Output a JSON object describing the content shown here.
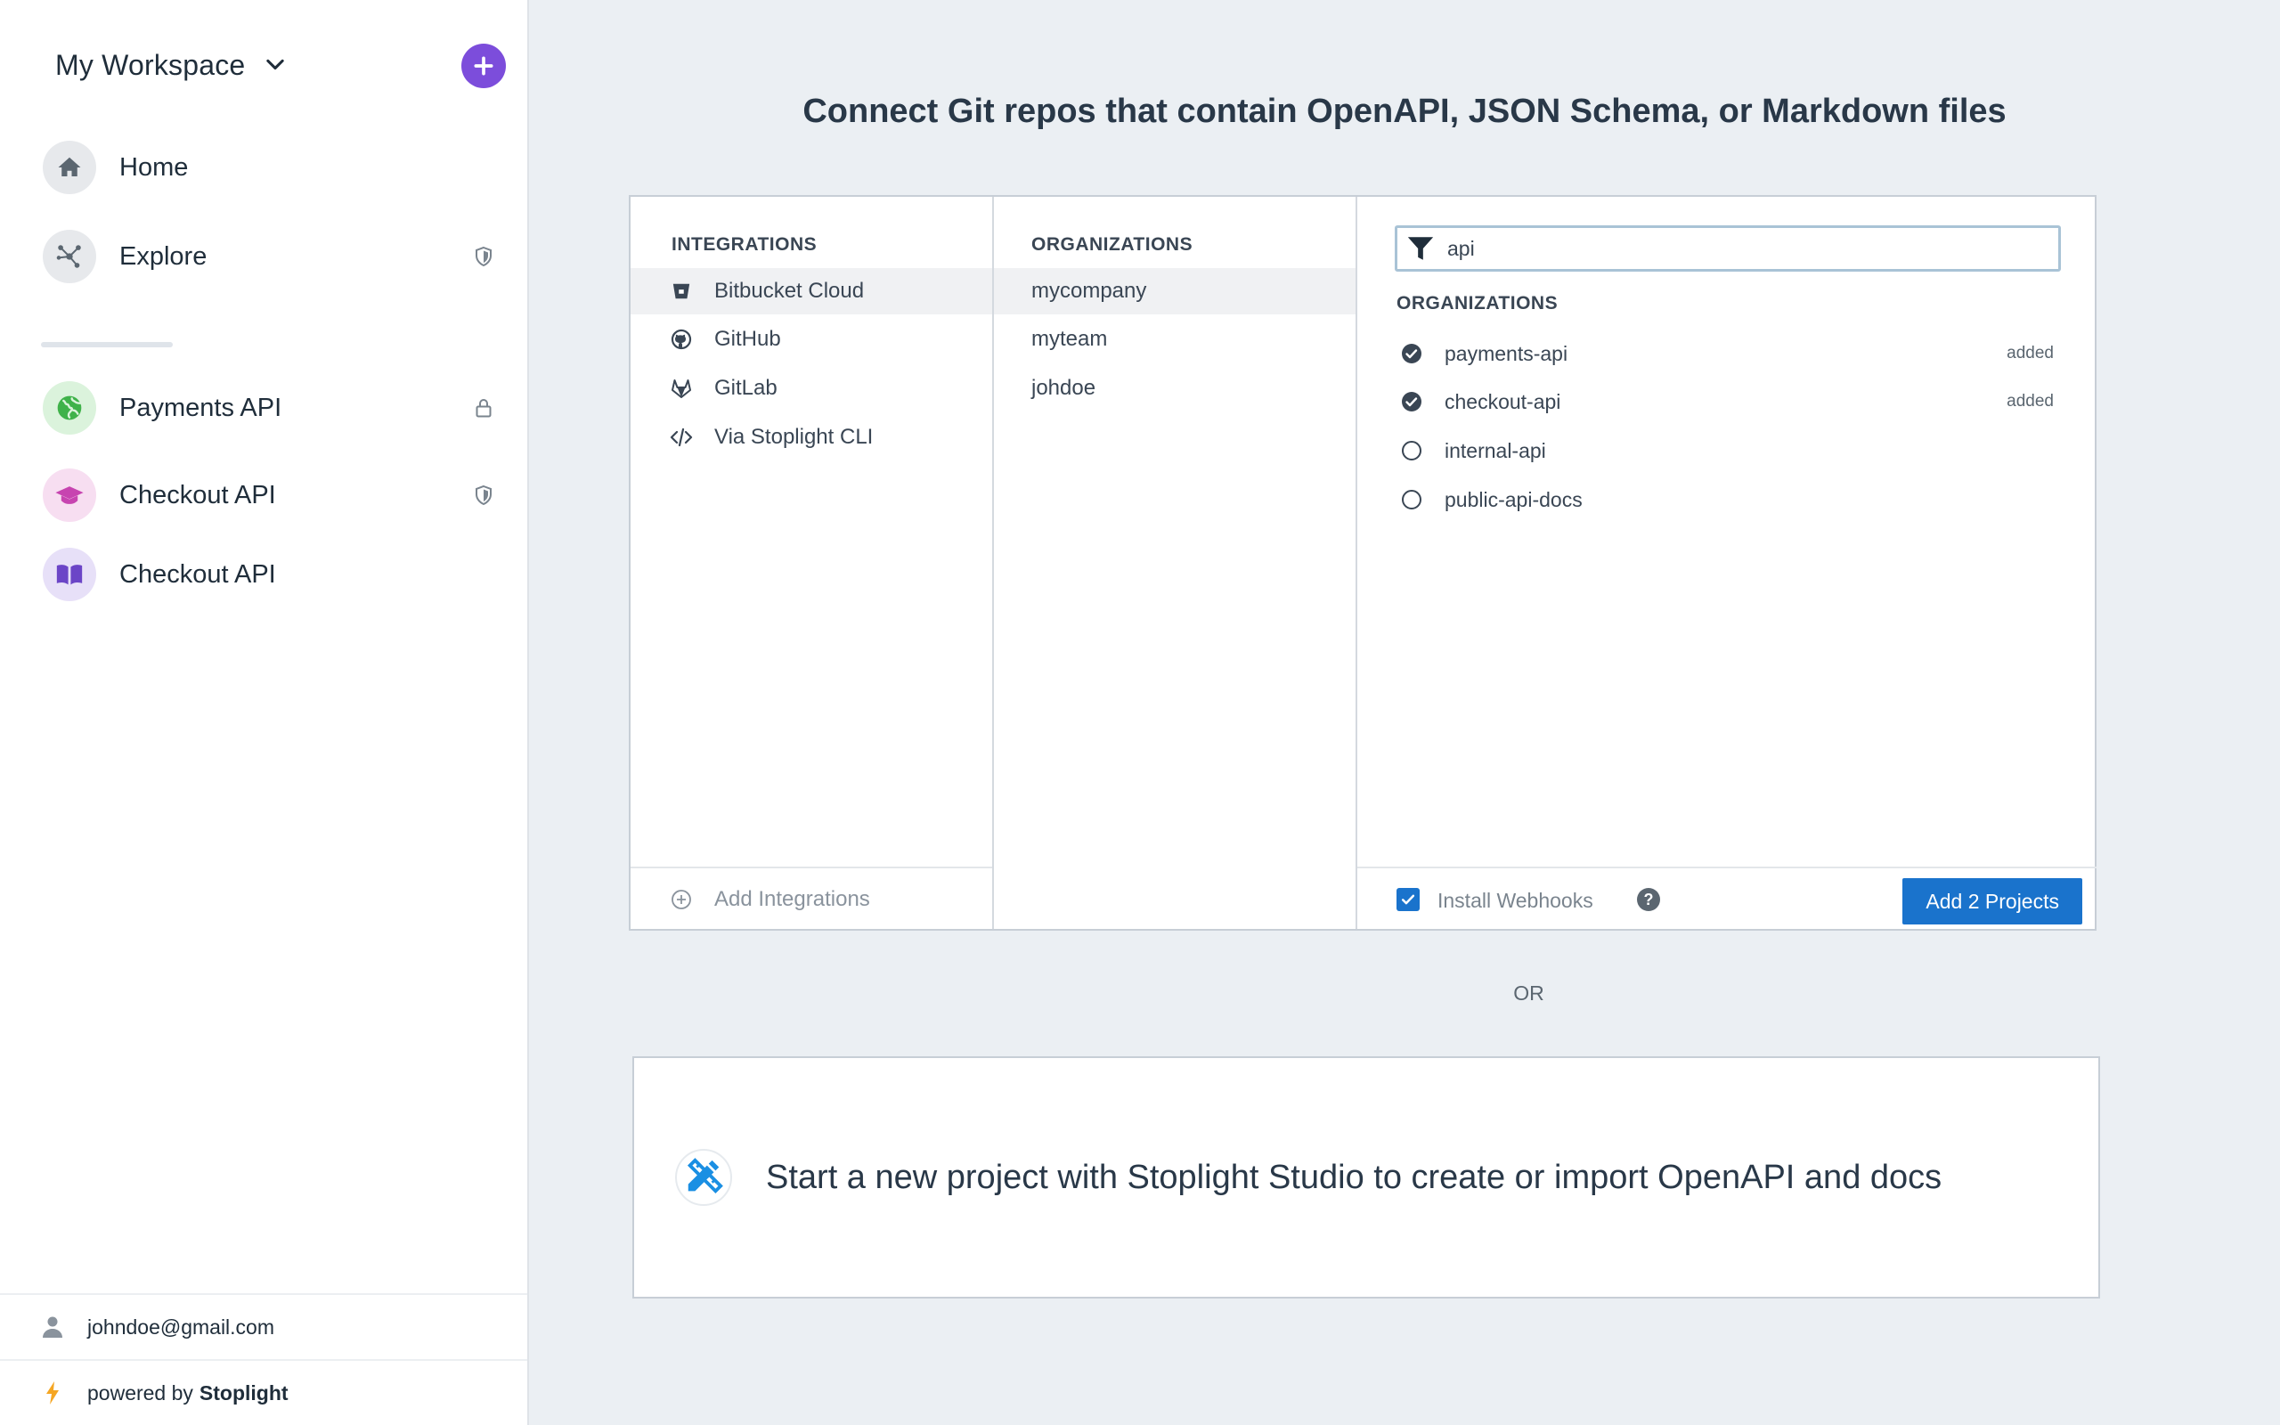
{
  "sidebar": {
    "workspace_title": "My Workspace",
    "nav": [
      {
        "label": "Home",
        "icon": "home-icon"
      },
      {
        "label": "Explore",
        "icon": "explore-icon"
      }
    ],
    "projects": [
      {
        "label": "Payments API",
        "icon": "globe-icon",
        "badge": "lock-icon"
      },
      {
        "label": "Checkout API",
        "icon": "graduation-cap-icon",
        "badge": "shield-icon"
      },
      {
        "label": "Checkout API",
        "icon": "book-icon",
        "badge": ""
      }
    ],
    "user_email": "johndoe@gmail.com",
    "powered_by": "powered by",
    "brand": "Stoplight"
  },
  "main": {
    "heading": "Connect Git repos that contain OpenAPI, JSON Schema, or Markdown files",
    "integrations": {
      "label": "INTEGRATIONS",
      "items": [
        {
          "label": "Bitbucket Cloud",
          "icon": "bitbucket-icon",
          "selected": true
        },
        {
          "label": "GitHub",
          "icon": "github-icon",
          "selected": false
        },
        {
          "label": "GitLab",
          "icon": "gitlab-icon",
          "selected": false
        },
        {
          "label": "Via Stoplight CLI",
          "icon": "code-icon",
          "selected": false
        }
      ],
      "add_label": "Add Integrations"
    },
    "organizations": {
      "label": "ORGANIZATIONS",
      "items": [
        {
          "label": "mycompany",
          "selected": true
        },
        {
          "label": "myteam",
          "selected": false
        },
        {
          "label": "johdoe",
          "selected": false
        }
      ]
    },
    "repos": {
      "search_value": "api",
      "label": "ORGANIZATIONS",
      "items": [
        {
          "label": "payments-api",
          "checked": true,
          "status": "added"
        },
        {
          "label": "checkout-api",
          "checked": true,
          "status": "added"
        },
        {
          "label": "internal-api",
          "checked": false,
          "status": ""
        },
        {
          "label": "public-api-docs",
          "checked": false,
          "status": ""
        }
      ]
    },
    "webhooks_label": "Install Webhooks",
    "webhooks_checked": true,
    "help_symbol": "?",
    "add_projects_label": "Add 2 Projects",
    "or_text": "OR",
    "studio_text": "Start a new project with Stoplight Studio to create or import OpenAPI and docs"
  },
  "colors": {
    "accent_purple": "#7c4ddb",
    "primary_blue": "#1a73cc",
    "background": "#ebeff3"
  }
}
